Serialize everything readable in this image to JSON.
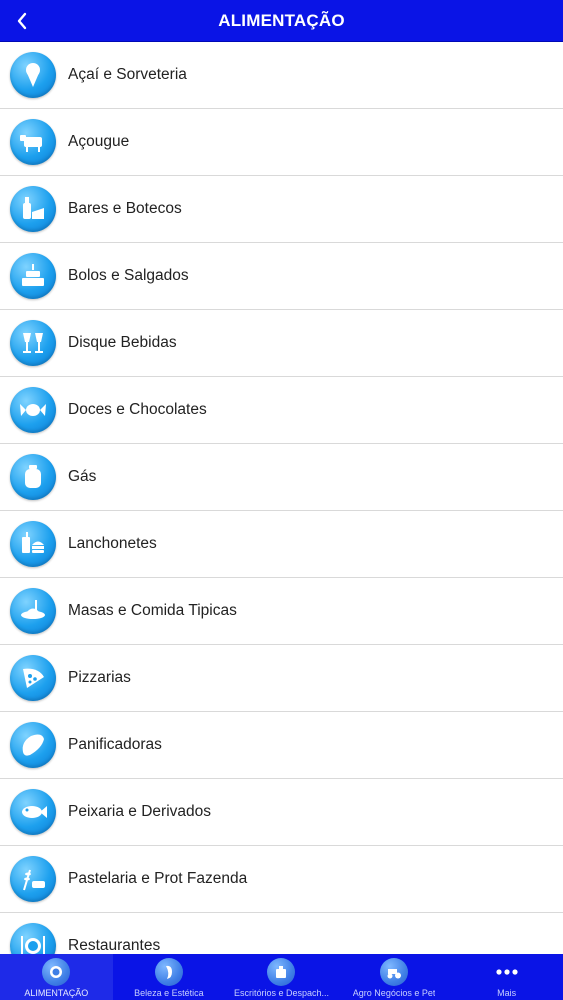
{
  "header": {
    "title": "ALIMENTAÇÃO",
    "back_icon": "chevron-left-icon"
  },
  "categories": [
    {
      "label": "Açaí e Sorveteria",
      "icon": "ice-cream-icon"
    },
    {
      "label": "Açougue",
      "icon": "cow-icon"
    },
    {
      "label": "Bares e Botecos",
      "icon": "bottle-cheese-icon"
    },
    {
      "label": "Bolos e Salgados",
      "icon": "cake-icon"
    },
    {
      "label": "Disque Bebidas",
      "icon": "wine-glasses-icon"
    },
    {
      "label": "Doces e Chocolates",
      "icon": "candy-icon"
    },
    {
      "label": "Gás",
      "icon": "gas-cylinder-icon"
    },
    {
      "label": "Lanchonetes",
      "icon": "burger-drink-icon"
    },
    {
      "label": "Masas e Comida Tipicas",
      "icon": "pasta-plate-icon"
    },
    {
      "label": "Pizzarias",
      "icon": "pizza-slice-icon"
    },
    {
      "label": "Panificadoras",
      "icon": "bread-icon"
    },
    {
      "label": "Peixaria e Derivados",
      "icon": "fish-icon"
    },
    {
      "label": "Pastelaria e Prot Fazenda",
      "icon": "wheat-food-icon"
    },
    {
      "label": "Restaurantes",
      "icon": "plate-cutlery-icon"
    }
  ],
  "tabbar": {
    "tabs": [
      {
        "label": "ALIMENTAÇÃO",
        "icon": "plate-icon",
        "active": true
      },
      {
        "label": "Beleza e Estética",
        "icon": "face-icon",
        "active": false
      },
      {
        "label": "Escritórios e Despach...",
        "icon": "office-icon",
        "active": false
      },
      {
        "label": "Agro Negócios e Pet",
        "icon": "tractor-icon",
        "active": false
      },
      {
        "label": "Mais",
        "icon": "more-dots-icon",
        "active": false
      }
    ]
  },
  "colors": {
    "header_bg": "#0a14e6",
    "icon_blue": "#1da0ee"
  }
}
